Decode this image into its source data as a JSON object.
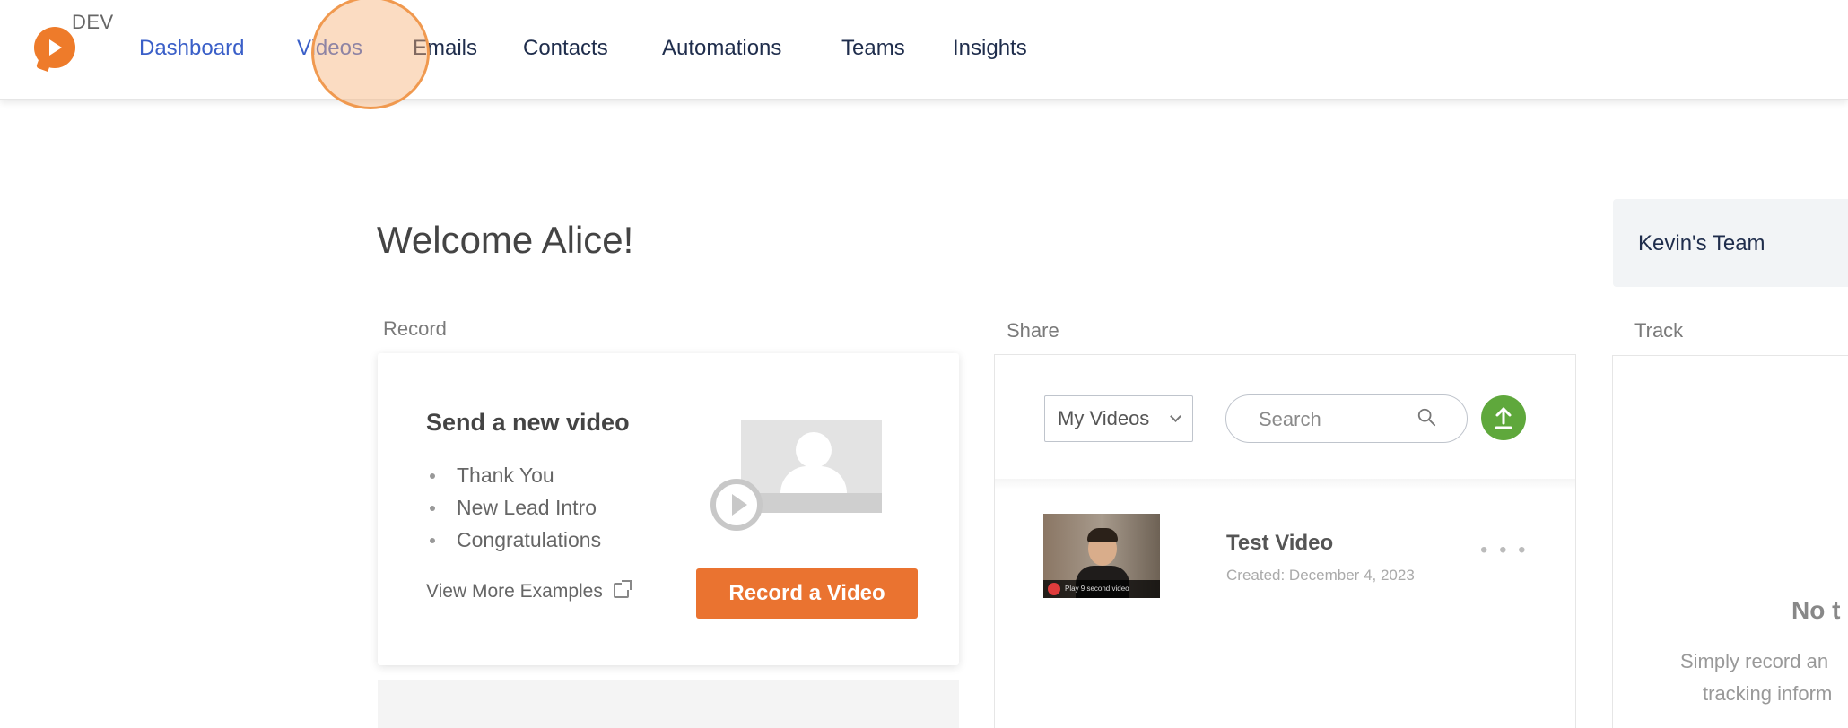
{
  "header": {
    "env_label": "DEV",
    "nav": [
      {
        "label": "Dashboard"
      },
      {
        "label": "Videos"
      },
      {
        "label": "Emails"
      },
      {
        "label": "Contacts"
      },
      {
        "label": "Automations"
      },
      {
        "label": "Teams"
      },
      {
        "label": "Insights"
      }
    ],
    "active_nav": "Videos"
  },
  "main": {
    "welcome": "Welcome Alice!",
    "team_name": "Kevin's Team",
    "sections": {
      "record": "Record",
      "share": "Share",
      "track": "Track"
    },
    "record_card": {
      "title": "Send a new video",
      "examples": [
        "Thank You",
        "New Lead Intro",
        "Congratulations"
      ],
      "more_examples": "View More Examples",
      "record_button": "Record a Video"
    },
    "share_card": {
      "filter_selected": "My Videos",
      "search_placeholder": "Search",
      "videos": [
        {
          "title": "Test Video",
          "created": "Created: December 4, 2023",
          "thumb_caption": "Play 9 second video"
        }
      ]
    },
    "track_card": {
      "empty_title": "No t",
      "empty_line1": "Simply record an",
      "empty_line2": "tracking inform"
    }
  },
  "colors": {
    "brand_orange": "#ea7330",
    "nav_active": "#3a5fc8",
    "nav_text": "#1f2d4c",
    "upload_green": "#5fa83c"
  },
  "icons": [
    "logo-play-icon",
    "external-link-icon",
    "chevron-down-icon",
    "search-icon",
    "upload-icon",
    "more-dots-icon"
  ]
}
